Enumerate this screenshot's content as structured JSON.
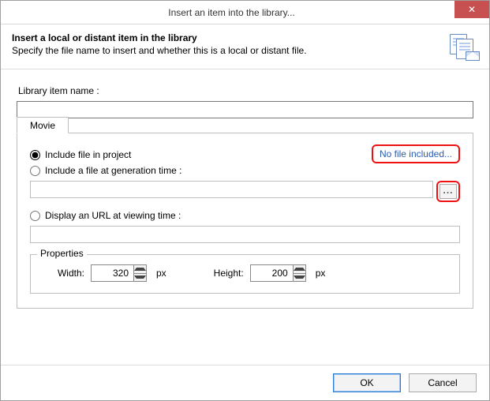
{
  "window": {
    "title": "Insert an item into the library...",
    "close_glyph": "✕"
  },
  "header": {
    "title": "Insert a local or distant item in the library",
    "subtitle": "Specify the file name to insert and whether this is a local or distant file."
  },
  "fields": {
    "library_item_name_label": "Library item name :",
    "library_item_name_value": ""
  },
  "tab": {
    "label": "Movie"
  },
  "options": {
    "include_in_project": "Include file in project",
    "include_at_gen": "Include a file at generation time :",
    "display_url": "Display an URL at viewing time :",
    "no_file_link": "No file included...",
    "gen_path_value": "",
    "url_value": "",
    "browse_glyph": "..."
  },
  "properties": {
    "legend": "Properties",
    "width_label": "Width:",
    "width_value": "320",
    "height_label": "Height:",
    "height_value": "200",
    "unit": "px"
  },
  "footer": {
    "ok": "OK",
    "cancel": "Cancel"
  }
}
